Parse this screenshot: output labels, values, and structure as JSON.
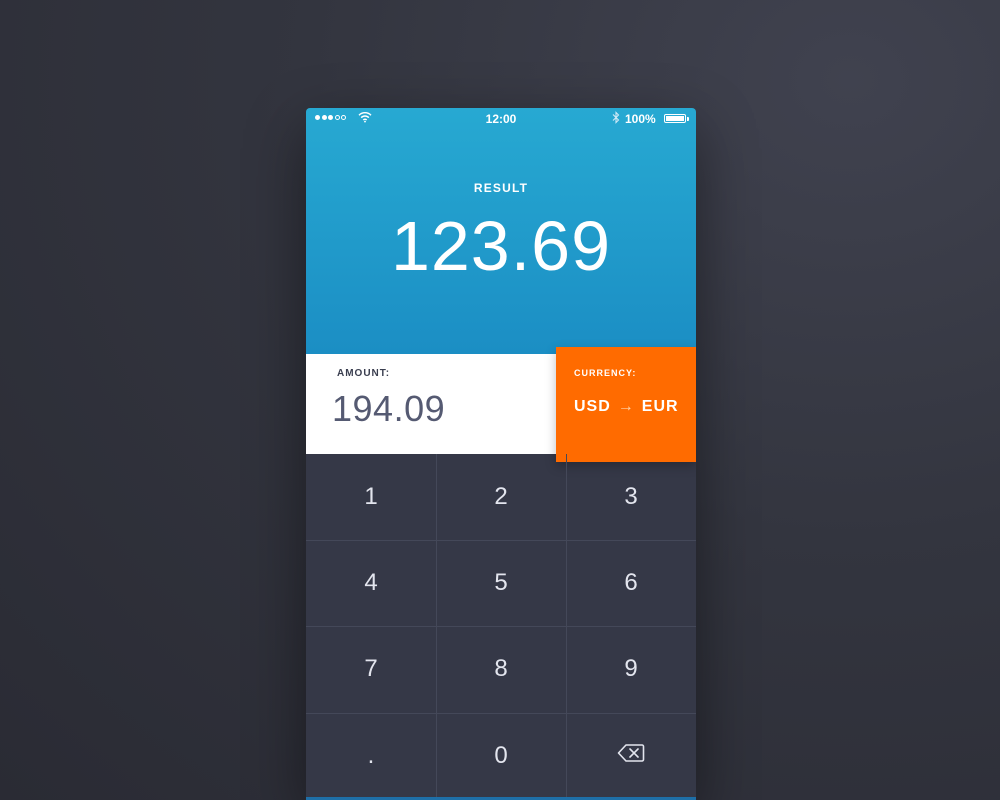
{
  "status_bar": {
    "signal_bars_filled": 3,
    "signal_bars_total": 5,
    "time": "12:00",
    "battery": "100%",
    "battery_level": 1.0
  },
  "result": {
    "label": "RESULT",
    "value": "123.69"
  },
  "amount": {
    "label": "AMOUNT:",
    "value": "194.09"
  },
  "currency": {
    "label": "CURRENCY:",
    "from": "USD",
    "arrow": "→",
    "to": "EUR"
  },
  "keypad": {
    "keys": [
      "1",
      "2",
      "3",
      "4",
      "5",
      "6",
      "7",
      "8",
      "9",
      ".",
      "0",
      "backspace-icon"
    ]
  },
  "colors": {
    "header_gradient_top": "#27a9d2",
    "header_gradient_bottom": "#1b8ec4",
    "currency_accent": "#ff6b00",
    "keypad_bg": "#353847",
    "page_bg": "#33353f"
  },
  "icons": {
    "wifi": "wifi-icon",
    "bluetooth": "bluetooth-icon",
    "battery": "battery-icon",
    "backspace": "backspace-icon"
  }
}
